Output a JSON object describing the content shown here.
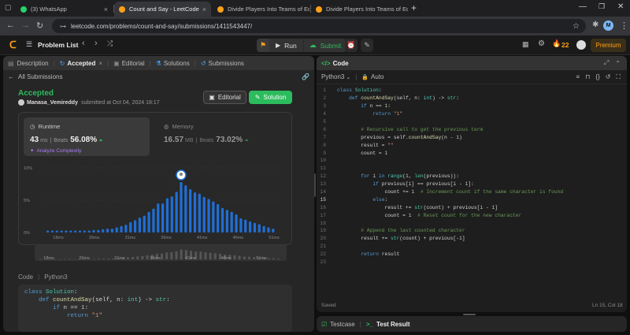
{
  "browser": {
    "tabs": [
      {
        "title": "(3) WhatsApp",
        "color": "#25d366"
      },
      {
        "title": "Count and Say - LeetCode",
        "color": "#ffa116"
      },
      {
        "title": "Divide Players Into Teams of Eq",
        "color": "#ffa116"
      },
      {
        "title": "Divide Players Into Teams of Eq",
        "color": "#ffa116"
      }
    ],
    "new_tab": "+",
    "url": "leetcode.com/problems/count-and-say/submissions/1411543447/",
    "profile_initial": "M"
  },
  "header": {
    "problem_list": "Problem List",
    "run": "Run",
    "submit": "Submit",
    "streak": "22",
    "premium": "Premium"
  },
  "left": {
    "tabs": {
      "description": "Description",
      "accepted": "Accepted",
      "editorial": "Editorial",
      "solutions": "Solutions",
      "submissions": "Submissions"
    },
    "all_submissions": "All Submissions",
    "status": "Accepted",
    "user": "Manasa_Vemireddy",
    "submitted_at": "submitted at Oct 04, 2024 18:17",
    "editorial_btn": "Editorial",
    "solution_btn": "Solution",
    "runtime": {
      "label": "Runtime",
      "value": "43",
      "unit": "ms",
      "sep": "|",
      "beats_label": "Beats",
      "beats": "56.08%",
      "analyze": "Analyze Complexity"
    },
    "memory": {
      "label": "Memory",
      "value": "16.57",
      "unit": "MB",
      "sep": "|",
      "beats_label": "Beats",
      "beats": "73.02%"
    },
    "code_label": "Code",
    "code_lang": "Python3",
    "code_preview": [
      "class Solution:",
      "    def countAndSay(self, n: int) -> str:",
      "        if n == 1:",
      "            return \"1\""
    ]
  },
  "chart_data": {
    "type": "bar",
    "x_ticks": [
      "18ms",
      "26ms",
      "31ms",
      "36ms",
      "41ms",
      "46ms",
      "51ms"
    ],
    "y_ticks": [
      "10%",
      "5%",
      "0%"
    ],
    "ylim": [
      0,
      10
    ],
    "highlight_label": "41ms",
    "values": [
      0.3,
      0.3,
      0.3,
      0.3,
      0.3,
      0.3,
      0.3,
      0.3,
      0.3,
      0.3,
      0.4,
      0.4,
      0.5,
      0.6,
      0.6,
      0.8,
      1.0,
      1.2,
      1.6,
      1.9,
      2.3,
      2.6,
      3.2,
      3.7,
      4.5,
      4.5,
      5.3,
      5.6,
      6.3,
      7.8,
      7.3,
      6.7,
      6.2,
      6.0,
      5.5,
      5.2,
      4.8,
      4.4,
      3.8,
      3.5,
      3.2,
      2.8,
      2.2,
      2.0,
      1.7,
      1.5,
      1.3,
      1.0,
      0.8,
      0.6
    ],
    "highlight_index": 29,
    "overview_ticks": [
      "18ms",
      "26ms",
      "31ms",
      "36ms",
      "41ms",
      "46ms",
      "51ms"
    ]
  },
  "editor": {
    "title": "Code",
    "language": "Python3",
    "mode": "Auto",
    "lines": [
      "class Solution:",
      "    def countAndSay(self, n: int) -> str:",
      "        if n == 1:",
      "            return \"1\"",
      "",
      "        # Recursive call to get the previous term",
      "        previous = self.countAndSay(n - 1)",
      "        result = \"\"",
      "        count = 1",
      "",
      "",
      "        for i in range(1, len(previous)):",
      "            if previous[i] == previous[i - 1]:",
      "                count += 1  # Increment count if the same character is found",
      "            else:",
      "                result += str(count) + previous[i - 1]",
      "                count = 1  # Reset count for the new character",
      "",
      "        # Append the last counted character",
      "        result += str(count) + previous[-1]",
      "",
      "        return result",
      ""
    ],
    "saved": "Saved",
    "cursor": "Ln 15, Col 18"
  },
  "bottom": {
    "testcase": "Testcase",
    "test_result": "Test Result"
  },
  "colors": {
    "accent_green": "#2cbb5d",
    "bar_blue": "#1f6fd6",
    "orange": "#ffa116"
  }
}
